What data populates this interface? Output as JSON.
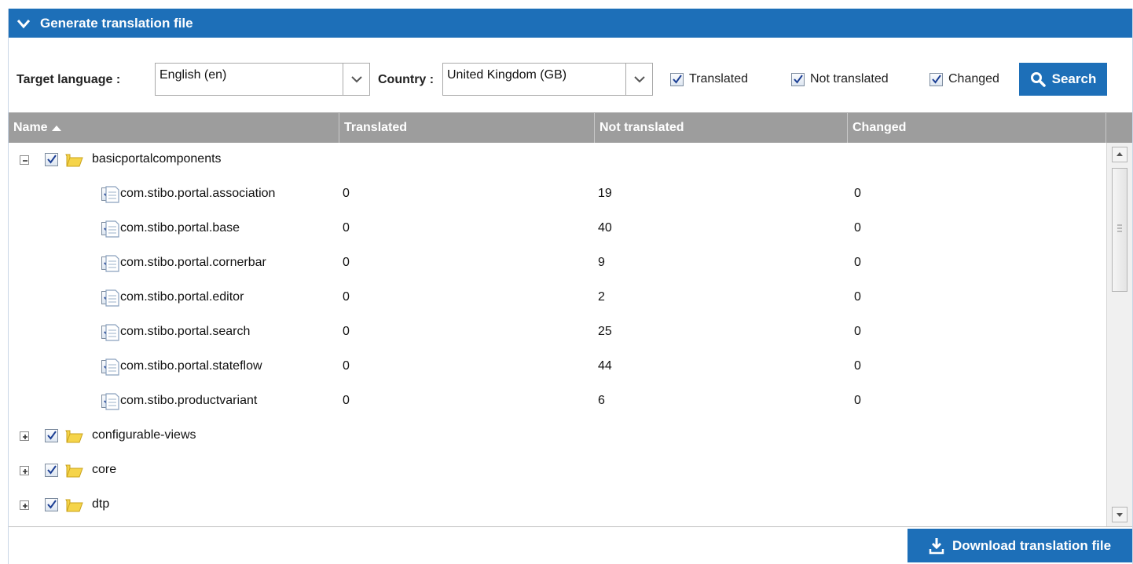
{
  "panel": {
    "title": "Generate translation file"
  },
  "filters": {
    "target_language_label": "Target language :",
    "target_language_value": "English (en)",
    "country_label": "Country :",
    "country_value": "United Kingdom (GB)",
    "checkboxes": [
      {
        "label": "Translated",
        "checked": true
      },
      {
        "label": "Not translated",
        "checked": true
      },
      {
        "label": "Changed",
        "checked": true
      }
    ],
    "search_label": "Search"
  },
  "grid": {
    "columns": [
      "Name",
      "Translated",
      "Not translated",
      "Changed"
    ],
    "sort_column": "Name",
    "sort_direction": "ascending",
    "rows": [
      {
        "name": "basicportalcomponents",
        "type": "folder",
        "expanded": true,
        "level": 0,
        "checked": true,
        "translated": "",
        "not_translated": "",
        "changed": ""
      },
      {
        "name": "com.stibo.portal.association",
        "type": "file",
        "level": 1,
        "checked": true,
        "translated": "0",
        "not_translated": "19",
        "changed": "0"
      },
      {
        "name": "com.stibo.portal.base",
        "type": "file",
        "level": 1,
        "checked": true,
        "translated": "0",
        "not_translated": "40",
        "changed": "0"
      },
      {
        "name": "com.stibo.portal.cornerbar",
        "type": "file",
        "level": 1,
        "checked": true,
        "translated": "0",
        "not_translated": "9",
        "changed": "0"
      },
      {
        "name": "com.stibo.portal.editor",
        "type": "file",
        "level": 1,
        "checked": true,
        "translated": "0",
        "not_translated": "2",
        "changed": "0"
      },
      {
        "name": "com.stibo.portal.search",
        "type": "file",
        "level": 1,
        "checked": true,
        "translated": "0",
        "not_translated": "25",
        "changed": "0"
      },
      {
        "name": "com.stibo.portal.stateflow",
        "type": "file",
        "level": 1,
        "checked": true,
        "translated": "0",
        "not_translated": "44",
        "changed": "0"
      },
      {
        "name": "com.stibo.productvariant",
        "type": "file",
        "level": 1,
        "checked": true,
        "translated": "0",
        "not_translated": "6",
        "changed": "0"
      },
      {
        "name": "configurable-views",
        "type": "folder",
        "expanded": false,
        "level": 0,
        "checked": true,
        "translated": "",
        "not_translated": "",
        "changed": ""
      },
      {
        "name": "core",
        "type": "folder",
        "expanded": false,
        "level": 0,
        "checked": true,
        "translated": "",
        "not_translated": "",
        "changed": ""
      },
      {
        "name": "dtp",
        "type": "folder",
        "expanded": false,
        "level": 0,
        "checked": true,
        "translated": "",
        "not_translated": "",
        "changed": ""
      }
    ]
  },
  "download_label": "Download translation file",
  "colors": {
    "accent": "#1d6fb8",
    "grid_header": "#9d9d9d",
    "folder": "#f2c94c"
  },
  "icons": {
    "collapse": "chevron-down-icon",
    "search": "search-icon",
    "download": "download-icon",
    "folder": "folder-icon",
    "file": "file-icon"
  }
}
